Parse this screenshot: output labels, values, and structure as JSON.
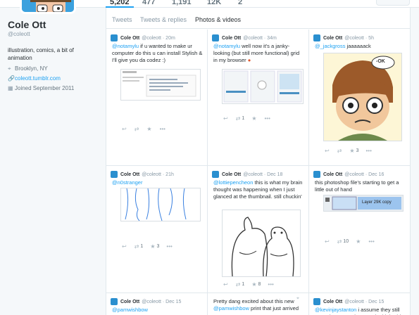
{
  "stats": [
    "5,202",
    "477",
    "1,191",
    "12K",
    "2"
  ],
  "profile": {
    "name": "Cole Ott",
    "handle": "@coleott",
    "bio": "illustration, comics, a bit of animation",
    "location": "Brooklyn, NY",
    "website": "coleott.tumblr.com",
    "joined": "Joined September 2011"
  },
  "tabs": [
    "Tweets",
    "Tweets & replies",
    "Photos & videos"
  ],
  "tweets": [
    {
      "name": "Cole Ott",
      "handle": "@coleott · 20m",
      "mention": "@notamylu",
      "text": " if u wanted to make ur computer do this u can install Stylish & I'll give you da codez :)"
    },
    {
      "name": "Cole Ott",
      "handle": "@coleott · 34m",
      "mention": "@notamylu",
      "text": " well now it's a janky-looking (but still more functional) grid in my browser",
      "retweets": "1"
    },
    {
      "name": "Cole Ott",
      "handle": "@coleott · 5h",
      "mention": "@_jackgross",
      "text": " jaaaaaack",
      "likes": "3"
    },
    {
      "name": "Cole Ott",
      "handle": "@coleott · 21h",
      "mention": "@n0stranger",
      "text": "",
      "retweets": "1",
      "likes": "3"
    },
    {
      "name": "Cole Ott",
      "handle": "@coleott · Dec 18",
      "mention": "@lottiepencheon",
      "text": " this is what my brain thought was happening when I just glanced at the thumbnail. still chuckin'",
      "retweets": "1",
      "likes": "8"
    },
    {
      "name": "Cole Ott",
      "handle": "@coleott · Dec 16",
      "mention": "",
      "text": "this photoshop file's starting to get a little out of hand",
      "retweets": "10"
    },
    {
      "name": "Cole Ott",
      "handle": "@coleott · Dec 15",
      "mention": "@pamwishbow",
      "text": ""
    },
    {
      "name": "",
      "handle": "",
      "mention": "@pamwishbow",
      "text_before": "Pretty dang excited about this new ",
      "text": " print that just arrived"
    },
    {
      "name": "Cole Ott",
      "handle": "@coleott · Dec 15",
      "mention": "@kevinjaystanton",
      "text": " i assume they still care about unreciprocated tablebuddy requests, hey"
    }
  ],
  "media_labels": {
    "psd_layer": "Layer 29K copy",
    "bubble": "-OK"
  },
  "colors": {
    "link": "#1da1f2",
    "avatar": "#2a8fcf"
  }
}
